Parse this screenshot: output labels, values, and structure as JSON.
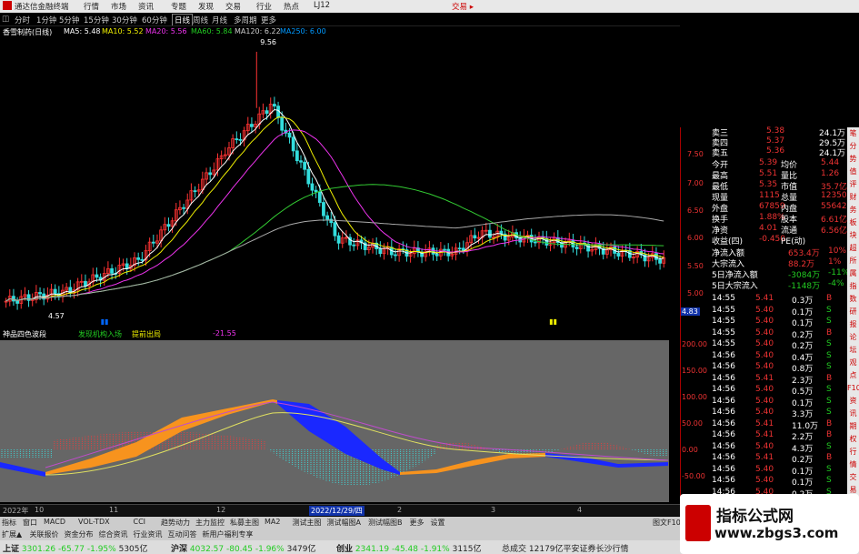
{
  "titlebar": {
    "app_title": "通达信金融终端",
    "menus": [
      "行情",
      "市场",
      "资讯",
      "专题",
      "发现",
      "交易",
      "行业",
      "热点",
      "LJ12"
    ],
    "trade_label": "交易 ▸"
  },
  "tabbar": {
    "tabs": [
      "分时",
      "1分钟",
      "5分钟",
      "15分钟",
      "30分钟",
      "60分钟",
      "日线",
      "周线",
      "月线",
      "多周期",
      "更多"
    ],
    "active": "日线"
  },
  "chart_header": {
    "stock": "香雪制药(日线)",
    "ma5": "MA5: 5.48",
    "ma10": "MA10: 5.52",
    "ma20": "MA20: 5.56",
    "ma60": "MA60: 5.84",
    "ma120": "MA120: 6.22",
    "ma250": "MA250: 6.00"
  },
  "price_labels": {
    "high": "9.56",
    "low": "4.57",
    "current": "4.83"
  },
  "axis_ticks": [
    "7.50",
    "7.00",
    "6.50",
    "6.00",
    "5.50",
    "5.00"
  ],
  "osc_header": {
    "name": "神品四色波段",
    "item1": "发现机构入场",
    "item2": "提前出局",
    "value": "-21.55"
  },
  "osc_ticks": [
    "200.00",
    "150.00",
    "100.00",
    "50.00",
    "0.00",
    "-50.00"
  ],
  "quote_top": [
    {
      "label": "卖三",
      "price": "5.38",
      "vol": "24.1万"
    },
    {
      "label": "卖四",
      "price": "5.37",
      "vol": "29.5万"
    },
    {
      "label": "卖五",
      "price": "5.36",
      "vol": "24.1万"
    }
  ],
  "quote_stats": [
    {
      "l1": "今开",
      "v1": "5.39",
      "l2": "均价",
      "v2": "5.44"
    },
    {
      "l1": "最高",
      "v1": "5.51",
      "l2": "量比",
      "v2": "1.26"
    },
    {
      "l1": "最低",
      "v1": "5.35",
      "l2": "市值",
      "v2": "35.7亿"
    },
    {
      "l1": "现量",
      "v1": "1115",
      "l2": "总量",
      "v2": "123501"
    },
    {
      "l1": "外盘",
      "v1": "67859",
      "l2": "内盘",
      "v2": "55642"
    },
    {
      "l1": "换手",
      "v1": "1.88%",
      "l2": "股本",
      "v2": "6.61亿"
    },
    {
      "l1": "净资",
      "v1": "4.01",
      "l2": "流通",
      "v2": "6.56亿"
    },
    {
      "l1": "收益(四)",
      "v1": "-0.450",
      "l2": "PE(动)",
      "v2": ""
    }
  ],
  "flows": [
    {
      "label": "净流入额",
      "value": "653.4万",
      "pct": "10%"
    },
    {
      "label": "大宗流入",
      "value": "88.2万",
      "pct": "1%"
    },
    {
      "label": "5日净流入额",
      "value": "-3084万",
      "pct": "-11%"
    },
    {
      "label": "5日大宗流入",
      "value": "-1148万",
      "pct": "-4%"
    }
  ],
  "ticks": [
    {
      "t": "14:55",
      "p": "5.41",
      "v": "0.3万",
      "d": "B"
    },
    {
      "t": "14:55",
      "p": "5.40",
      "v": "0.1万",
      "d": "S"
    },
    {
      "t": "14:55",
      "p": "5.40",
      "v": "0.1万",
      "d": "S"
    },
    {
      "t": "14:55",
      "p": "5.40",
      "v": "0.2万",
      "d": "B"
    },
    {
      "t": "14:55",
      "p": "5.40",
      "v": "0.2万",
      "d": "S"
    },
    {
      "t": "14:56",
      "p": "5.40",
      "v": "0.4万",
      "d": "S"
    },
    {
      "t": "14:56",
      "p": "5.40",
      "v": "0.8万",
      "d": "S"
    },
    {
      "t": "14:56",
      "p": "5.41",
      "v": "2.3万",
      "d": "B"
    },
    {
      "t": "14:56",
      "p": "5.40",
      "v": "0.5万",
      "d": "S"
    },
    {
      "t": "14:56",
      "p": "5.40",
      "v": "0.1万",
      "d": "S"
    },
    {
      "t": "14:56",
      "p": "5.40",
      "v": "3.3万",
      "d": "S"
    },
    {
      "t": "14:56",
      "p": "5.41",
      "v": "11.0万",
      "d": "B"
    },
    {
      "t": "14:56",
      "p": "5.41",
      "v": "2.2万",
      "d": "B"
    },
    {
      "t": "14:56",
      "p": "5.40",
      "v": "4.3万",
      "d": "S"
    },
    {
      "t": "14:56",
      "p": "5.41",
      "v": "0.2万",
      "d": "B"
    },
    {
      "t": "14:56",
      "p": "5.40",
      "v": "0.1万",
      "d": "S"
    },
    {
      "t": "14:56",
      "p": "5.40",
      "v": "0.1万",
      "d": "S"
    },
    {
      "t": "14:56",
      "p": "5.40",
      "v": "0.2万",
      "d": "S"
    }
  ],
  "sidebar": [
    "笔",
    "分",
    "势",
    "值",
    "评",
    "财",
    "务",
    "板",
    "块",
    "超",
    "所",
    "属",
    "指",
    "数",
    "研",
    "报",
    "论",
    "坛",
    "观",
    "点",
    "F10",
    "资",
    "讯",
    "期",
    "权",
    "行",
    "情",
    "交",
    "易",
    "大",
    "单"
  ],
  "datebar": [
    "2022年",
    "10",
    "11",
    "12",
    "2022/12/29/四",
    "2",
    "3",
    "4"
  ],
  "bottomtabs": [
    "指标",
    "窗口",
    "MACD",
    "VOL-TDX",
    "CCI",
    "趋势动力",
    "主力监控",
    "私募主图",
    "MA2",
    "测试主图",
    "测试幅图A",
    "测试幅图B",
    "更多",
    "设置"
  ],
  "bottomtabs2": [
    "扩展▲",
    "关联报价",
    "资金分布",
    "综合资讯",
    "行业资讯",
    "互动问答",
    "新用户福利专享"
  ],
  "bottom_right": "图文F10",
  "mode_label": "模板",
  "statusbar": [
    {
      "label": "上证",
      "value": "3301.26",
      "chg": "-65.77",
      "pct": "-1.95%",
      "amt": "5305亿"
    },
    {
      "label": "沪深",
      "value": "4032.57",
      "chg": "-80.45",
      "pct": "-1.96%",
      "amt": "3479亿"
    },
    {
      "label": "创业",
      "value": "2341.19",
      "chg": "-45.48",
      "pct": "-1.91%",
      "amt": "3115亿"
    }
  ],
  "status_extra": {
    "label": "总成交",
    "value": "12179亿",
    "news": "平安证券长沙行情"
  },
  "watermark": {
    "title": "指标公式网",
    "url": "www.zbgs3.com"
  },
  "colors": {
    "up": "#e33",
    "down": "#2cc",
    "orange": "#f7931e",
    "blue": "#1030ff"
  }
}
